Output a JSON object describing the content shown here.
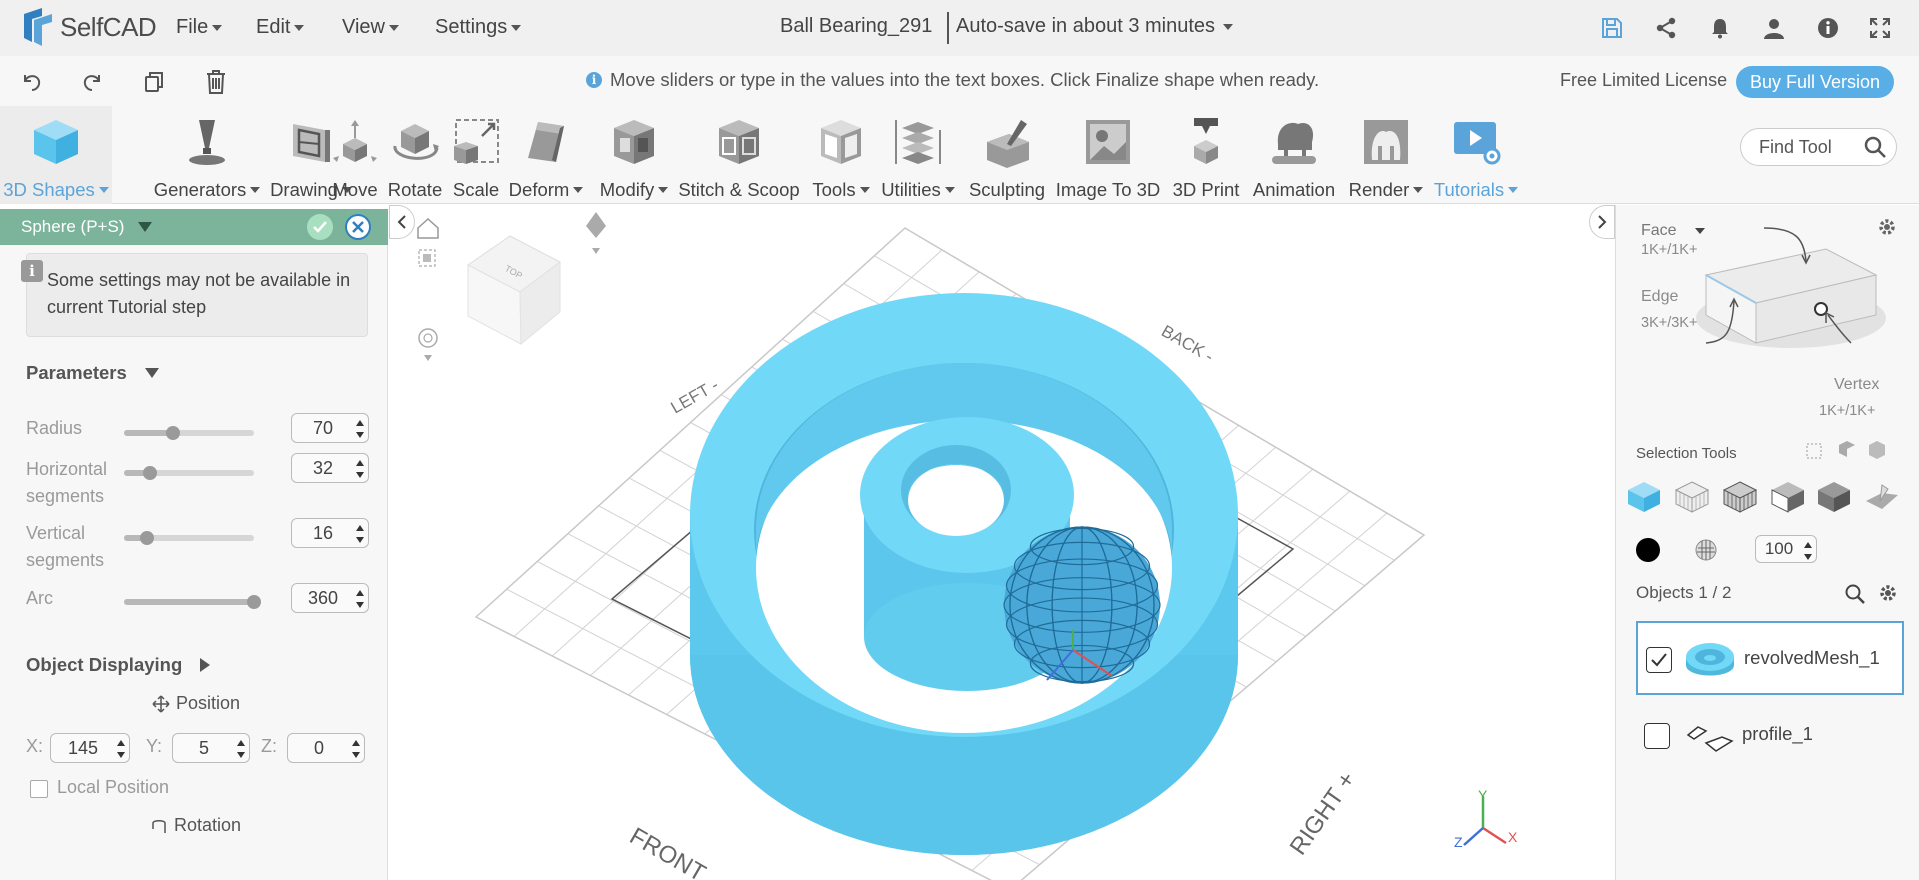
{
  "app": {
    "name": "SelfCAD"
  },
  "menu": {
    "file": "File",
    "edit": "Edit",
    "view": "View",
    "settings": "Settings"
  },
  "document": {
    "title": "Ball Bearing_291",
    "autosave": "Auto-save in about 3 minutes"
  },
  "hint_bar": {
    "message": "Move sliders or type in the values into the text boxes. Click Finalize shape when ready.",
    "license": "Free Limited License",
    "buy_button": "Buy Full Version"
  },
  "tools": [
    {
      "label": "3D Shapes",
      "dropdown": true,
      "icon": "cube-icon"
    },
    {
      "label": "Generators",
      "dropdown": true,
      "icon": "generator-icon"
    },
    {
      "label": "Drawing",
      "dropdown": true,
      "icon": "drawing-icon"
    },
    {
      "label": "Move",
      "dropdown": false,
      "icon": "move-icon"
    },
    {
      "label": "Rotate",
      "dropdown": false,
      "icon": "rotate-icon"
    },
    {
      "label": "Scale",
      "dropdown": false,
      "icon": "scale-icon"
    },
    {
      "label": "Deform",
      "dropdown": true,
      "icon": "deform-icon"
    },
    {
      "label": "Modify",
      "dropdown": true,
      "icon": "modify-icon"
    },
    {
      "label": "Stitch & Scoop",
      "dropdown": false,
      "icon": "stitch-scoop-icon"
    },
    {
      "label": "Tools",
      "dropdown": true,
      "icon": "tools-icon"
    },
    {
      "label": "Utilities",
      "dropdown": true,
      "icon": "utilities-icon"
    },
    {
      "label": "Sculpting",
      "dropdown": false,
      "icon": "sculpting-icon"
    },
    {
      "label": "Image To 3D",
      "dropdown": false,
      "icon": "image-to-3d-icon"
    },
    {
      "label": "3D Print",
      "dropdown": false,
      "icon": "3d-print-icon"
    },
    {
      "label": "Animation",
      "dropdown": false,
      "icon": "animation-icon"
    },
    {
      "label": "Render",
      "dropdown": true,
      "icon": "render-icon"
    },
    {
      "label": "Tutorials",
      "dropdown": true,
      "icon": "tutorials-icon"
    }
  ],
  "find_tool": {
    "placeholder": "Find Tool"
  },
  "left_panel": {
    "title": "Sphere (P+S)",
    "notice": "Some settings may not be available in current Tutorial step",
    "parameters_title": "Parameters",
    "params": [
      {
        "label": "Radius",
        "value": "70",
        "level": 0.38
      },
      {
        "label": "Horizontal segments",
        "value": "32",
        "level": 0.2
      },
      {
        "label": "Vertical segments",
        "value": "16",
        "level": 0.18
      },
      {
        "label": "Arc",
        "value": "360",
        "level": 1.0
      }
    ],
    "object_displaying": "Object Displaying",
    "position_title": "Position",
    "position": {
      "x_label": "X:",
      "x": "145",
      "y_label": "Y:",
      "y": "5",
      "z_label": "Z:",
      "z": "0"
    },
    "local_position": "Local Position",
    "rotation_title": "Rotation"
  },
  "viewport": {
    "cube_label": "TOP",
    "labels": {
      "left": "LEFT -",
      "back": "BACK -",
      "right": "RIGHT +",
      "front": "FRONT"
    },
    "axes": {
      "x": "X",
      "y": "Y",
      "z": "Z"
    },
    "colors": {
      "mesh": "#6dd3f2",
      "mesh_dark": "#4fb9dd",
      "sphere": "#4aa8d8",
      "grid": "#d0d0d0"
    }
  },
  "right_panel": {
    "face_label": "Face",
    "face_count": "1K+/1K+",
    "edge_label": "Edge",
    "edge_count": "3K+/3K+",
    "vertex_label": "Vertex",
    "vertex_count": "1K+/1K+",
    "selection_tools": "Selection Tools",
    "opacity": "100",
    "objects_count": "Objects 1 / 2",
    "objects": [
      {
        "name": "revolvedMesh_1",
        "checked": true,
        "selected": true
      },
      {
        "name": "profile_1",
        "checked": false,
        "selected": false
      }
    ]
  },
  "accent_color": "#5ba4d9"
}
